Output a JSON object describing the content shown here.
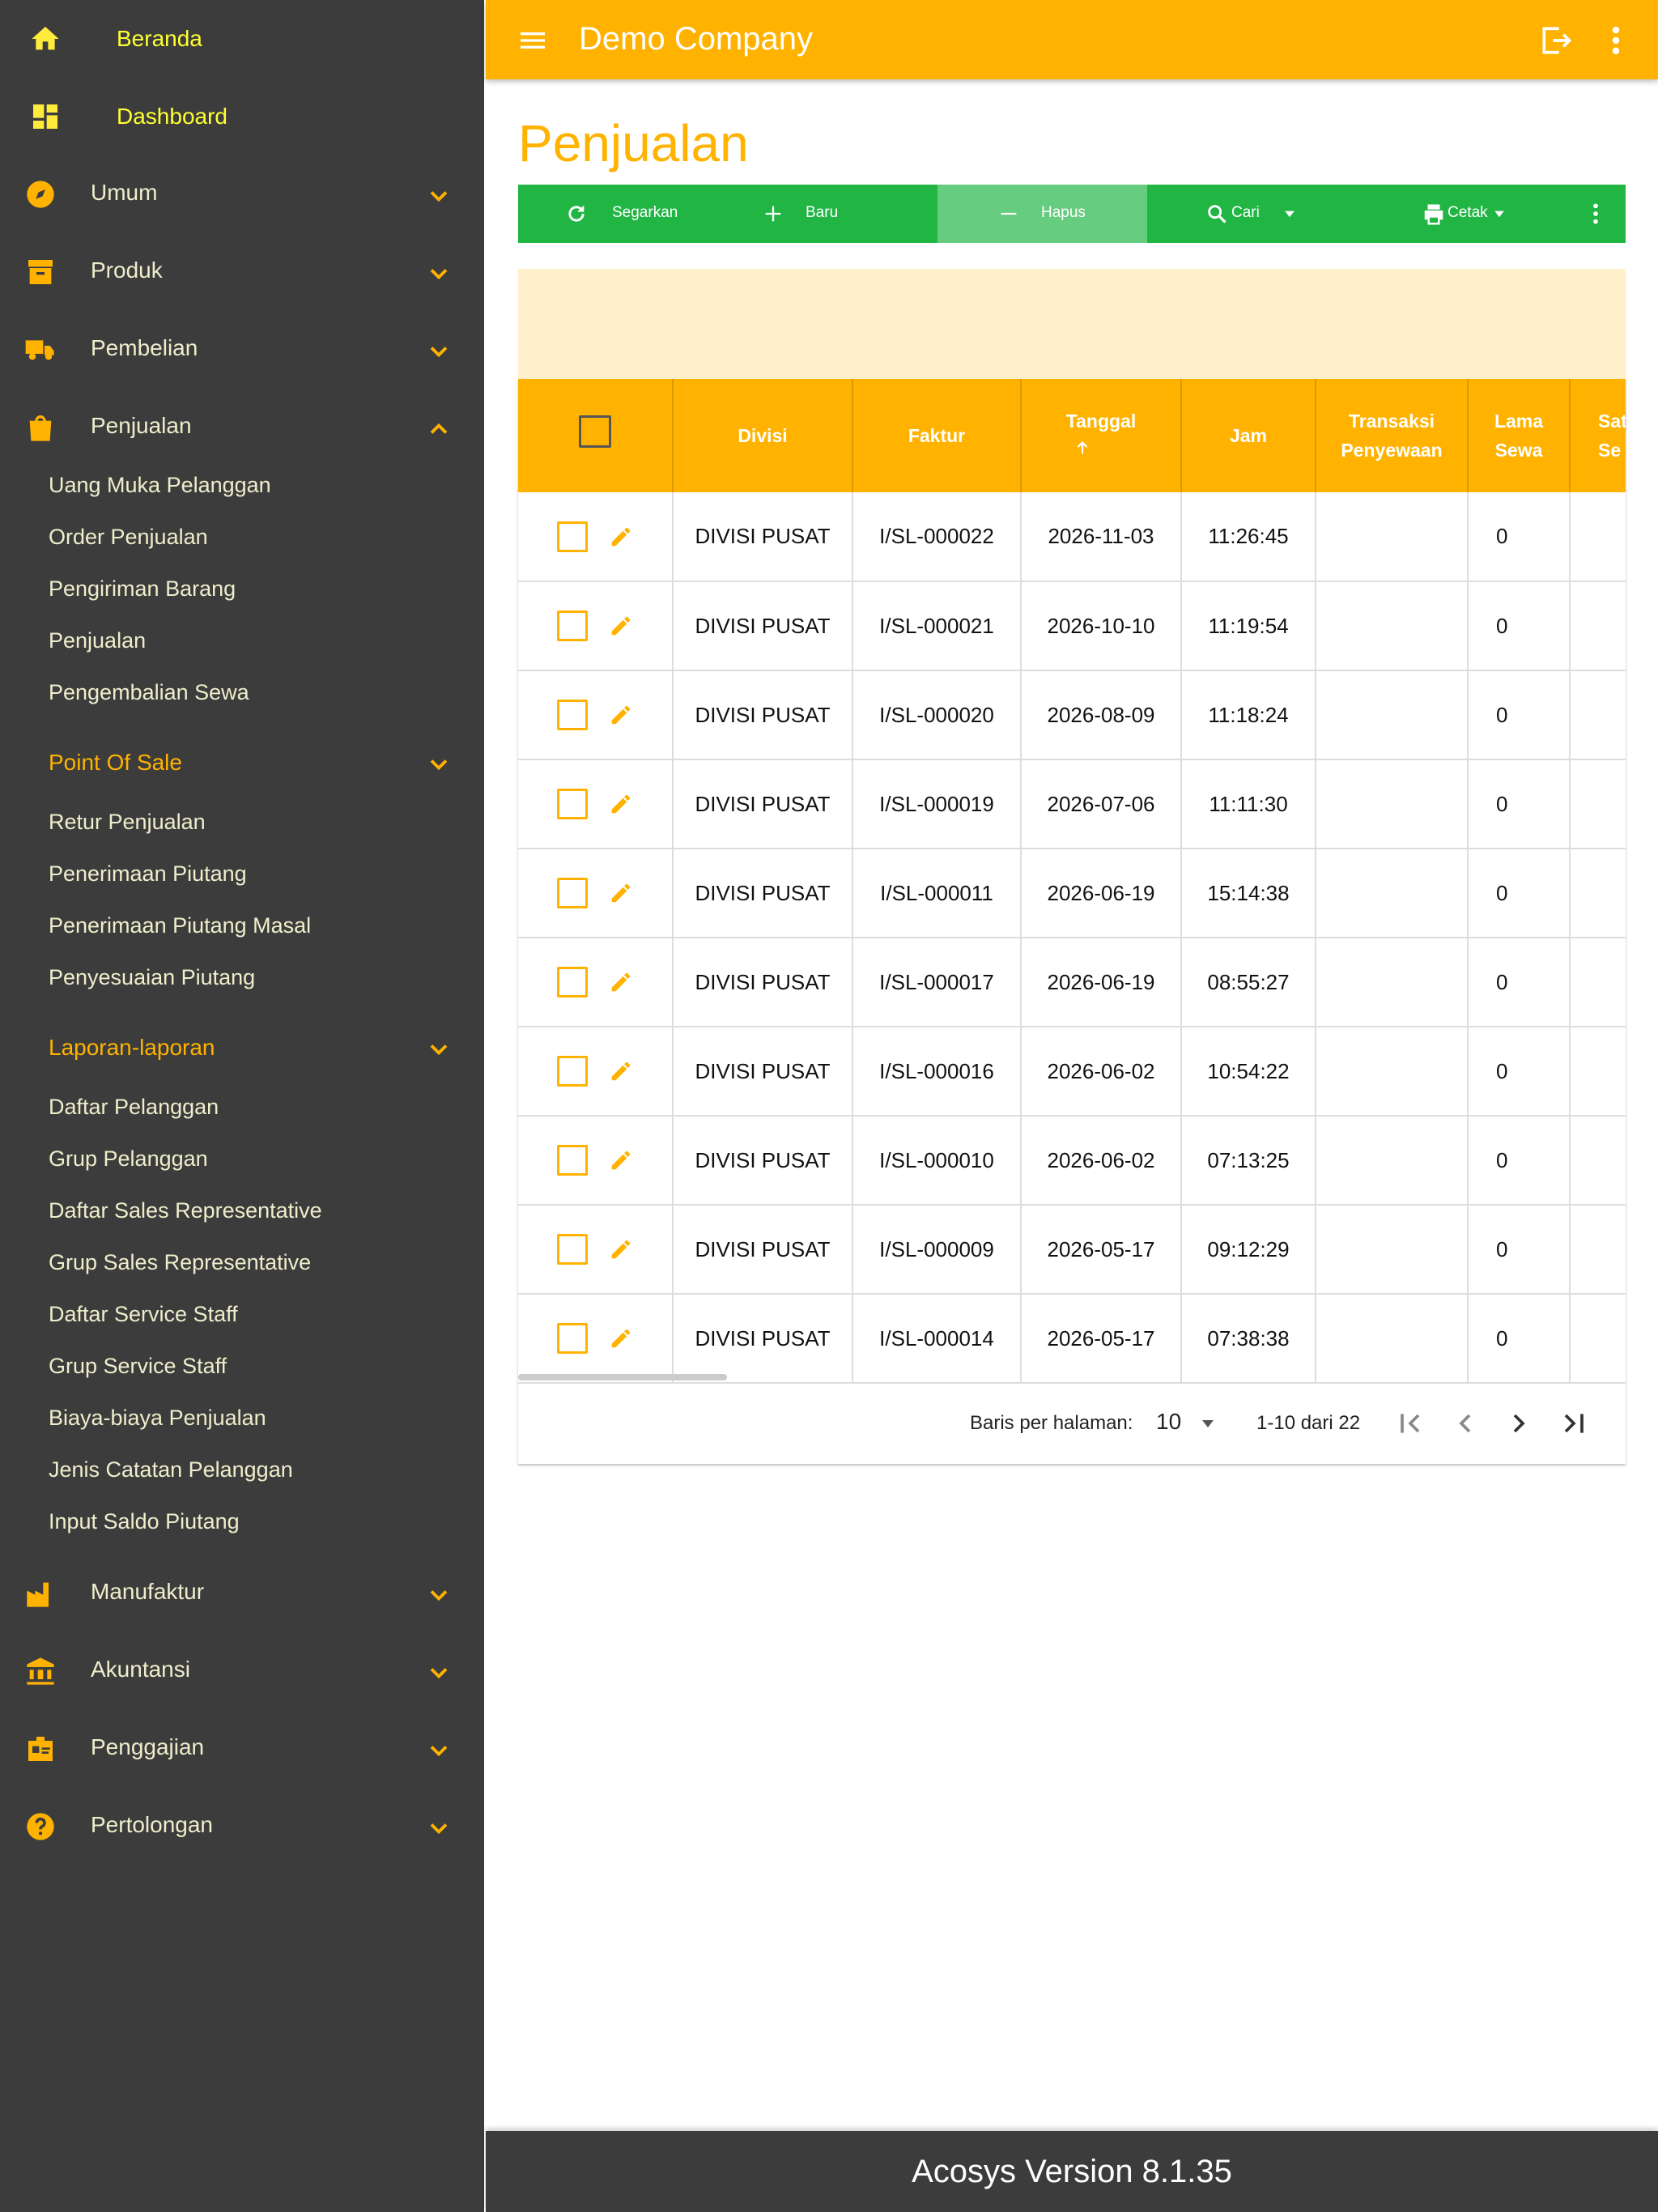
{
  "sidebar": {
    "top_items": [
      {
        "label": "Beranda",
        "icon": "home-icon"
      },
      {
        "label": "Dashboard",
        "icon": "dashboard-icon"
      }
    ],
    "groups": {
      "umum": "Umum",
      "produk": "Produk",
      "pembelian": "Pembelian",
      "penjualan": "Penjualan",
      "manufaktur": "Manufaktur",
      "akuntansi": "Akuntansi",
      "penggajian": "Penggajian",
      "pertolongan": "Pertolongan"
    },
    "penjualan_items": [
      "Uang Muka Pelanggan",
      "Order Penjualan",
      "Pengiriman Barang",
      "Penjualan",
      "Pengembalian Sewa"
    ],
    "pos_section": "Point Of Sale",
    "pos_items": [
      "Retur Penjualan",
      "Penerimaan Piutang",
      "Penerimaan Piutang Masal",
      "Penyesuaian Piutang"
    ],
    "laporan_section": "Laporan-laporan",
    "laporan_items": [
      "Daftar Pelanggan",
      "Grup Pelanggan",
      "Daftar Sales Representative",
      "Grup Sales Representative",
      "Daftar Service Staff",
      "Grup Service Staff",
      "Biaya-biaya Penjualan",
      "Jenis Catatan Pelanggan",
      "Input Saldo Piutang"
    ]
  },
  "appbar": {
    "title": "Demo Company"
  },
  "page": {
    "title": "Penjualan"
  },
  "toolbar": {
    "refresh": "Segarkan",
    "new": "Baru",
    "delete": "Hapus",
    "search": "Cari",
    "print": "Cetak"
  },
  "table": {
    "headers": {
      "divisi": "Divisi",
      "faktur": "Faktur",
      "tanggal": "Tanggal",
      "jam": "Jam",
      "transaksi_1": "Transaksi",
      "transaksi_2": "Penyewaan",
      "lama_1": "Lama",
      "lama_2": "Sewa",
      "sat_1": "Sat",
      "sat_2": "Se"
    },
    "rows": [
      {
        "divisi": "DIVISI PUSAT",
        "faktur": "I/SL-000022",
        "tanggal": "2026-11-03",
        "jam": "11:26:45",
        "transaksi": "",
        "lama": "0"
      },
      {
        "divisi": "DIVISI PUSAT",
        "faktur": "I/SL-000021",
        "tanggal": "2026-10-10",
        "jam": "11:19:54",
        "transaksi": "",
        "lama": "0"
      },
      {
        "divisi": "DIVISI PUSAT",
        "faktur": "I/SL-000020",
        "tanggal": "2026-08-09",
        "jam": "11:18:24",
        "transaksi": "",
        "lama": "0"
      },
      {
        "divisi": "DIVISI PUSAT",
        "faktur": "I/SL-000019",
        "tanggal": "2026-07-06",
        "jam": "11:11:30",
        "transaksi": "",
        "lama": "0"
      },
      {
        "divisi": "DIVISI PUSAT",
        "faktur": "I/SL-000011",
        "tanggal": "2026-06-19",
        "jam": "15:14:38",
        "transaksi": "",
        "lama": "0"
      },
      {
        "divisi": "DIVISI PUSAT",
        "faktur": "I/SL-000017",
        "tanggal": "2026-06-19",
        "jam": "08:55:27",
        "transaksi": "",
        "lama": "0"
      },
      {
        "divisi": "DIVISI PUSAT",
        "faktur": "I/SL-000016",
        "tanggal": "2026-06-02",
        "jam": "10:54:22",
        "transaksi": "",
        "lama": "0"
      },
      {
        "divisi": "DIVISI PUSAT",
        "faktur": "I/SL-000010",
        "tanggal": "2026-06-02",
        "jam": "07:13:25",
        "transaksi": "",
        "lama": "0"
      },
      {
        "divisi": "DIVISI PUSAT",
        "faktur": "I/SL-000009",
        "tanggal": "2026-05-17",
        "jam": "09:12:29",
        "transaksi": "",
        "lama": "0"
      },
      {
        "divisi": "DIVISI PUSAT",
        "faktur": "I/SL-000014",
        "tanggal": "2026-05-17",
        "jam": "07:38:38",
        "transaksi": "",
        "lama": "0"
      }
    ]
  },
  "pagination": {
    "rows_per_page_label": "Baris per halaman:",
    "rows_per_page": "10",
    "range": "1-10 dari 22"
  },
  "footer": {
    "version": "Acosys Version 8.1.35"
  },
  "colors": {
    "accent": "#ffb300",
    "sidebar": "#3c3c3c",
    "toolbar": "#21b544",
    "banner": "#fff0cc"
  }
}
